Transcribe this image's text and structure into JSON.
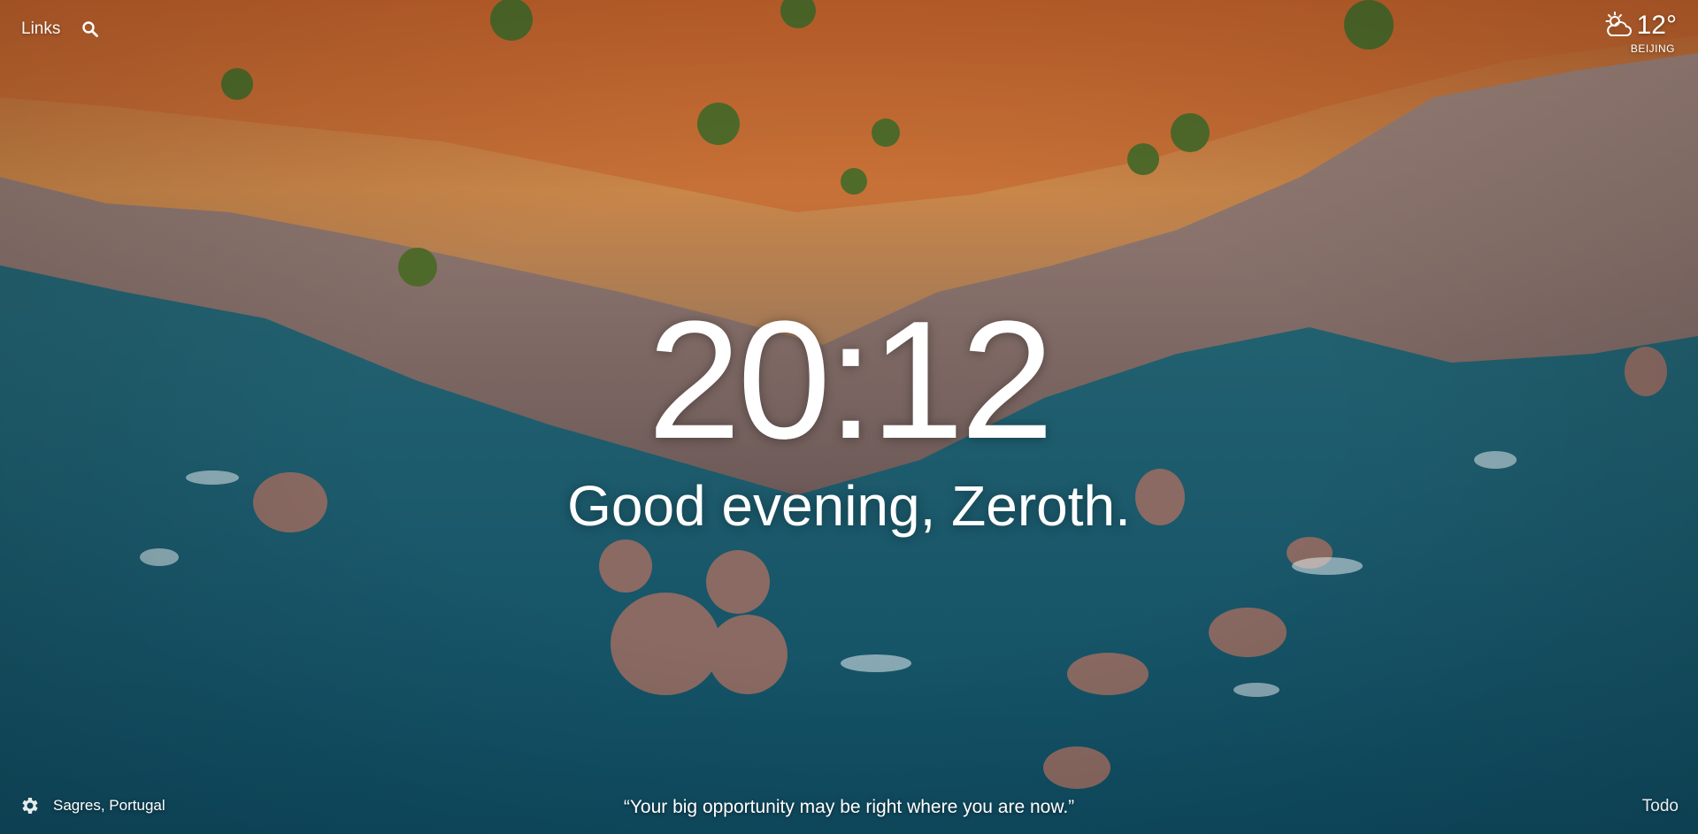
{
  "top_left": {
    "links_label": "Links",
    "search_icon": "search-icon"
  },
  "weather": {
    "icon": "partly-cloudy-icon",
    "temperature": "12°",
    "location": "BEIJING"
  },
  "center": {
    "time": "20:12",
    "greeting": "Good evening, Zeroth."
  },
  "bottom": {
    "settings_icon": "gear-icon",
    "photo_location": "Sagres, Portugal",
    "quote": "“Your big opportunity may be right where you are now.”",
    "todo_label": "Todo"
  },
  "colors": {
    "text": "#ffffff",
    "sea": "#1b5f73",
    "cliff": "#c8743a",
    "rock": "#9c7f7a"
  }
}
